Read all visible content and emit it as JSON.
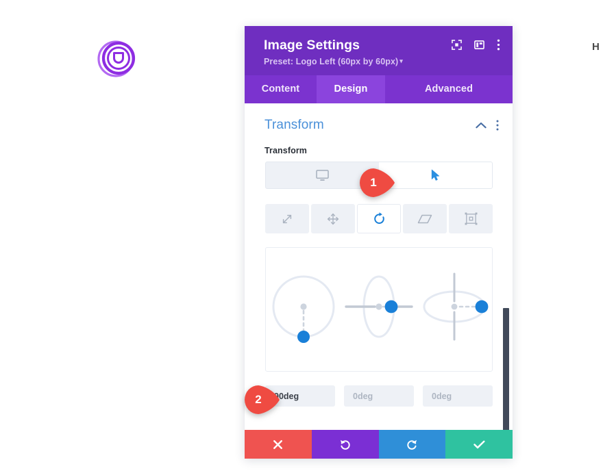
{
  "logo": {
    "name": "divi-logo",
    "color": "#8e2de2"
  },
  "edge_text": "H",
  "panel": {
    "title": "Image Settings",
    "preset": "Preset: Logo Left (60px by 60px)",
    "preset_caret": "▾",
    "header_icons": [
      {
        "name": "fullscreen-icon",
        "label": "Expand"
      },
      {
        "name": "layout-icon",
        "label": "Layout"
      },
      {
        "name": "kebab-menu-icon",
        "label": "More options"
      }
    ],
    "tabs": [
      {
        "name": "tab-content",
        "label": "Content",
        "active": false
      },
      {
        "name": "tab-design",
        "label": "Design",
        "active": true
      },
      {
        "name": "tab-advanced",
        "label": "Advanced",
        "active": false
      }
    ],
    "colors": {
      "header": "#6f2ec0",
      "tabbar": "#7b33cf",
      "tab_active": "#8b44dd",
      "section_title": "#4a90d9",
      "accent_blue": "#1a80d8",
      "cancel": "#ef5350",
      "undo": "#7b2fd4",
      "redo": "#2f8fd8",
      "save": "#2fc2a0"
    }
  },
  "section": {
    "title": "Transform",
    "collapse_icon": "chevron-up-icon",
    "menu_icon": "kebab-menu-icon"
  },
  "field": {
    "label": "Transform",
    "segments": [
      {
        "name": "segment-desktop",
        "icon": "desktop-icon",
        "active": false
      },
      {
        "name": "segment-hover",
        "icon": "cursor-icon",
        "active": true
      }
    ],
    "tools": [
      {
        "name": "tool-scale",
        "icon": "scale-arrow-icon",
        "active": false
      },
      {
        "name": "tool-move",
        "icon": "move-arrows-icon",
        "active": false
      },
      {
        "name": "tool-rotate",
        "icon": "rotate-icon",
        "active": true
      },
      {
        "name": "tool-skew",
        "icon": "skew-parallelogram-icon",
        "active": false
      },
      {
        "name": "tool-origin",
        "icon": "transform-origin-icon",
        "active": false
      }
    ],
    "dials": [
      {
        "name": "rotate-z-dial",
        "axis": "Z",
        "angle_deg": 90
      },
      {
        "name": "rotate-x-dial",
        "axis": "X",
        "angle_deg": 0
      },
      {
        "name": "rotate-y-dial",
        "axis": "Y",
        "angle_deg": 0
      }
    ],
    "values": [
      {
        "name": "rotate-z-input",
        "value": "90deg",
        "placeholder": "0deg",
        "is_placeholder": false
      },
      {
        "name": "rotate-x-input",
        "value": "0deg",
        "placeholder": "0deg",
        "is_placeholder": true
      },
      {
        "name": "rotate-y-input",
        "value": "0deg",
        "placeholder": "0deg",
        "is_placeholder": true
      }
    ]
  },
  "actions": [
    {
      "name": "cancel-button",
      "icon": "close-icon",
      "color": "#ef5350"
    },
    {
      "name": "undo-button",
      "icon": "undo-icon",
      "color": "#7b2fd4"
    },
    {
      "name": "redo-button",
      "icon": "redo-icon",
      "color": "#2f8fd8"
    },
    {
      "name": "save-button",
      "icon": "check-icon",
      "color": "#2fc2a0"
    }
  ],
  "callouts": [
    {
      "name": "callout-1",
      "number": "1",
      "color": "#ef4b42"
    },
    {
      "name": "callout-2",
      "number": "2",
      "color": "#ef4b42"
    }
  ]
}
